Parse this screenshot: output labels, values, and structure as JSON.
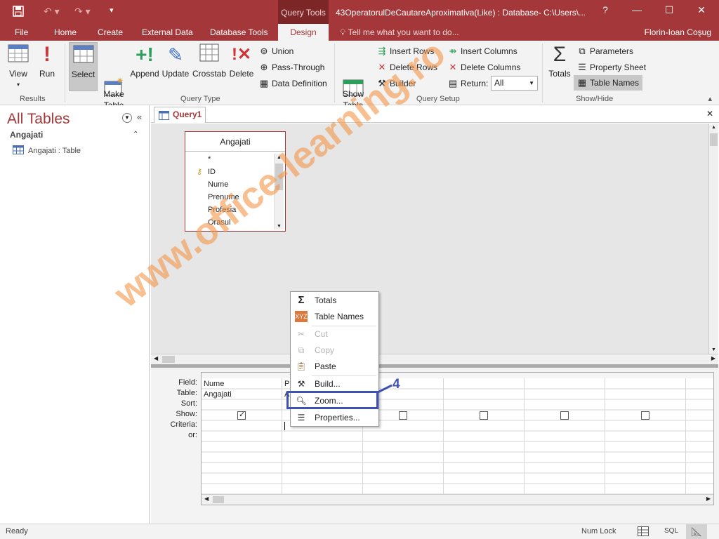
{
  "window": {
    "title": "43OperatorulDeCautareAproximativa(Like) : Database- C:\\Users\\...",
    "context_tab": "Query Tools",
    "controls": {
      "help": "?",
      "minimize": "—",
      "restore": "☐",
      "close": "✕"
    }
  },
  "quick_access": {
    "save_icon": "save-icon",
    "undo_icon": "undo-icon",
    "redo_icon": "redo-icon"
  },
  "tabs": {
    "file": "File",
    "home": "Home",
    "create": "Create",
    "external": "External Data",
    "dbtools": "Database Tools",
    "design": "Design",
    "tellme": "Tell me what you want to do...",
    "user": "Florin-Ioan Coşug"
  },
  "ribbon": {
    "results": {
      "label": "Results",
      "view": "View",
      "run": "Run"
    },
    "query_type": {
      "label": "Query Type",
      "select": "Select",
      "make_table": "Make\nTable",
      "append": "Append",
      "update": "Update",
      "crosstab": "Crosstab",
      "delete": "Delete",
      "union": "Union",
      "pass_through": "Pass-Through",
      "data_definition": "Data Definition"
    },
    "query_setup": {
      "label": "Query Setup",
      "show_table": "Show\nTable",
      "insert_rows": "Insert Rows",
      "delete_rows": "Delete Rows",
      "builder": "Builder",
      "insert_columns": "Insert Columns",
      "delete_columns": "Delete Columns",
      "return_label": "Return:",
      "return_value": "All"
    },
    "show_hide": {
      "label": "Show/Hide",
      "totals": "Totals",
      "parameters": "Parameters",
      "property_sheet": "Property Sheet",
      "table_names": "Table Names"
    }
  },
  "nav": {
    "title": "All Tables",
    "group": "Angajati",
    "item": "Angajati : Table"
  },
  "doc": {
    "tab": "Query1",
    "close": "✕"
  },
  "table": {
    "name": "Angajati",
    "fields": [
      "*",
      "ID",
      "Nume",
      "Prenume",
      "Profesia",
      "Orasul"
    ]
  },
  "grid": {
    "row_labels": [
      "Field:",
      "Table:",
      "Sort:",
      "Show:",
      "Criteria:",
      "or:"
    ],
    "col1_field": "Nume",
    "col1_table": "Angajati",
    "col2_field_partial": "P",
    "col2_table_partial": "A"
  },
  "context_menu": {
    "items": [
      "Totals",
      "Table Names",
      "Cut",
      "Copy",
      "Paste",
      "Build...",
      "Zoom...",
      "Properties..."
    ],
    "disabled": [
      "Cut",
      "Copy"
    ],
    "highlighted": "Zoom..."
  },
  "annotation": {
    "step": "4",
    "color": "#3f51b5"
  },
  "watermark": "www.office-learning.ro",
  "status": {
    "left": "Ready",
    "numlock": "Num Lock",
    "sql": "SQL"
  },
  "colors": {
    "accent": "#a4373a"
  }
}
